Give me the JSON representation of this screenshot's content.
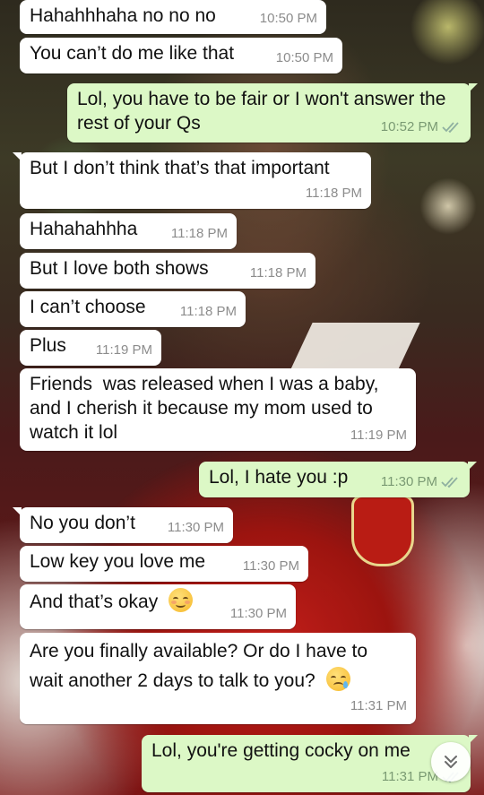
{
  "messages": [
    {
      "dir": "in",
      "text": "Hahahhhaha no no no",
      "time": "10:50 PM"
    },
    {
      "dir": "in",
      "text": "You can’t do me like that",
      "time": "10:50 PM"
    },
    {
      "dir": "out",
      "text": "Lol, you have to be fair or I won't answer the rest of your Qs",
      "time": "10:52 PM",
      "status": "read"
    },
    {
      "dir": "in",
      "text": "But I don’t think that’s that important",
      "time": "11:18 PM"
    },
    {
      "dir": "in",
      "text": "Hahahahhha",
      "time": "11:18 PM"
    },
    {
      "dir": "in",
      "text": "But I love both shows",
      "time": "11:18 PM"
    },
    {
      "dir": "in",
      "text": "I can’t choose",
      "time": "11:18 PM"
    },
    {
      "dir": "in",
      "text": "Plus",
      "time": "11:19 PM"
    },
    {
      "dir": "in",
      "text": "Friends  was released when I was a baby, and I cherish it because my mom used to watch it lol",
      "time": "11:19 PM"
    },
    {
      "dir": "out",
      "text": "Lol, I hate you :p",
      "time": "11:30 PM",
      "status": "read"
    },
    {
      "dir": "in",
      "text": "No you don’t",
      "time": "11:30 PM"
    },
    {
      "dir": "in",
      "text": "Low key you love me",
      "time": "11:30 PM"
    },
    {
      "dir": "in",
      "text": "And that’s okay",
      "emoji": "relieved-face",
      "time": "11:30 PM"
    },
    {
      "dir": "in",
      "text": "Are you finally available? Or do I have to wait another 2 days to talk to you?",
      "emoji": "sleepy-face",
      "time": "11:31 PM"
    },
    {
      "dir": "out",
      "text": "Lol, you're getting cocky on me",
      "time": "11:31 PM",
      "status": "read"
    }
  ],
  "colors": {
    "incoming": "#ffffff",
    "outgoing": "#dcf8c6",
    "read_tick": "#4fc3f7"
  },
  "icons": {
    "scroll_down": "double-chevron-down-icon"
  }
}
